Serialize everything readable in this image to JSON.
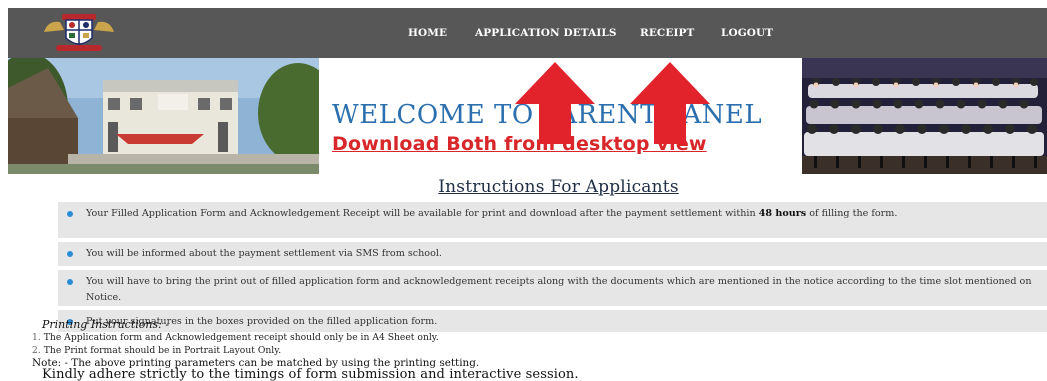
{
  "nav": {
    "items": [
      {
        "label": "HOME"
      },
      {
        "label": "APPLICATION DETAILS"
      },
      {
        "label": "RECEIPT"
      },
      {
        "label": "LOGOUT"
      }
    ]
  },
  "banner": {
    "welcome": "WELCOME TO PARENT PANEL",
    "download": "Download Both from desktop view"
  },
  "instructions": {
    "title": "Instructions For Applicants",
    "items": [
      {
        "text": "Your Filled Application Form and Acknowledgement Receipt will be available for print and download after the payment settlement within ",
        "bold": "48 hours",
        "tail": " of filling the form."
      },
      {
        "text": "You will be informed about the payment settlement via SMS from school.",
        "bold": "",
        "tail": ""
      },
      {
        "text": "You will have to bring the print out of filled application form and acknowledgement receipts along with the documents which are mentioned in the notice according to the time slot mentioned on Notice.",
        "bold": "",
        "tail": ""
      },
      {
        "text": "Put your signatures in the boxes provided on the filled application form.",
        "bold": "",
        "tail": ""
      }
    ]
  },
  "printing": {
    "heading": "Printing Instructions: -",
    "items": [
      {
        "num": "1.",
        "text": "The Application form and Acknowledgement receipt should only be in A4 Sheet only."
      },
      {
        "num": "2.",
        "text": "The Print format should be in Portrait Layout Only."
      }
    ],
    "note": "Note: - The above printing parameters can be matched by using the printing setting.",
    "adhere": "Kindly adhere strictly to the timings of form submission and interactive session."
  },
  "colors": {
    "navbar": "#575757",
    "welcome": "#2b6fae",
    "download": "#d8262b",
    "arrow": "#e3232c",
    "bullet": "#2a8fd6",
    "item_bg": "#e6e6e6"
  },
  "icons": {
    "logo": "school-crest-logo",
    "arrows": "red-up-arrow",
    "bullet": "bullet-dot"
  }
}
